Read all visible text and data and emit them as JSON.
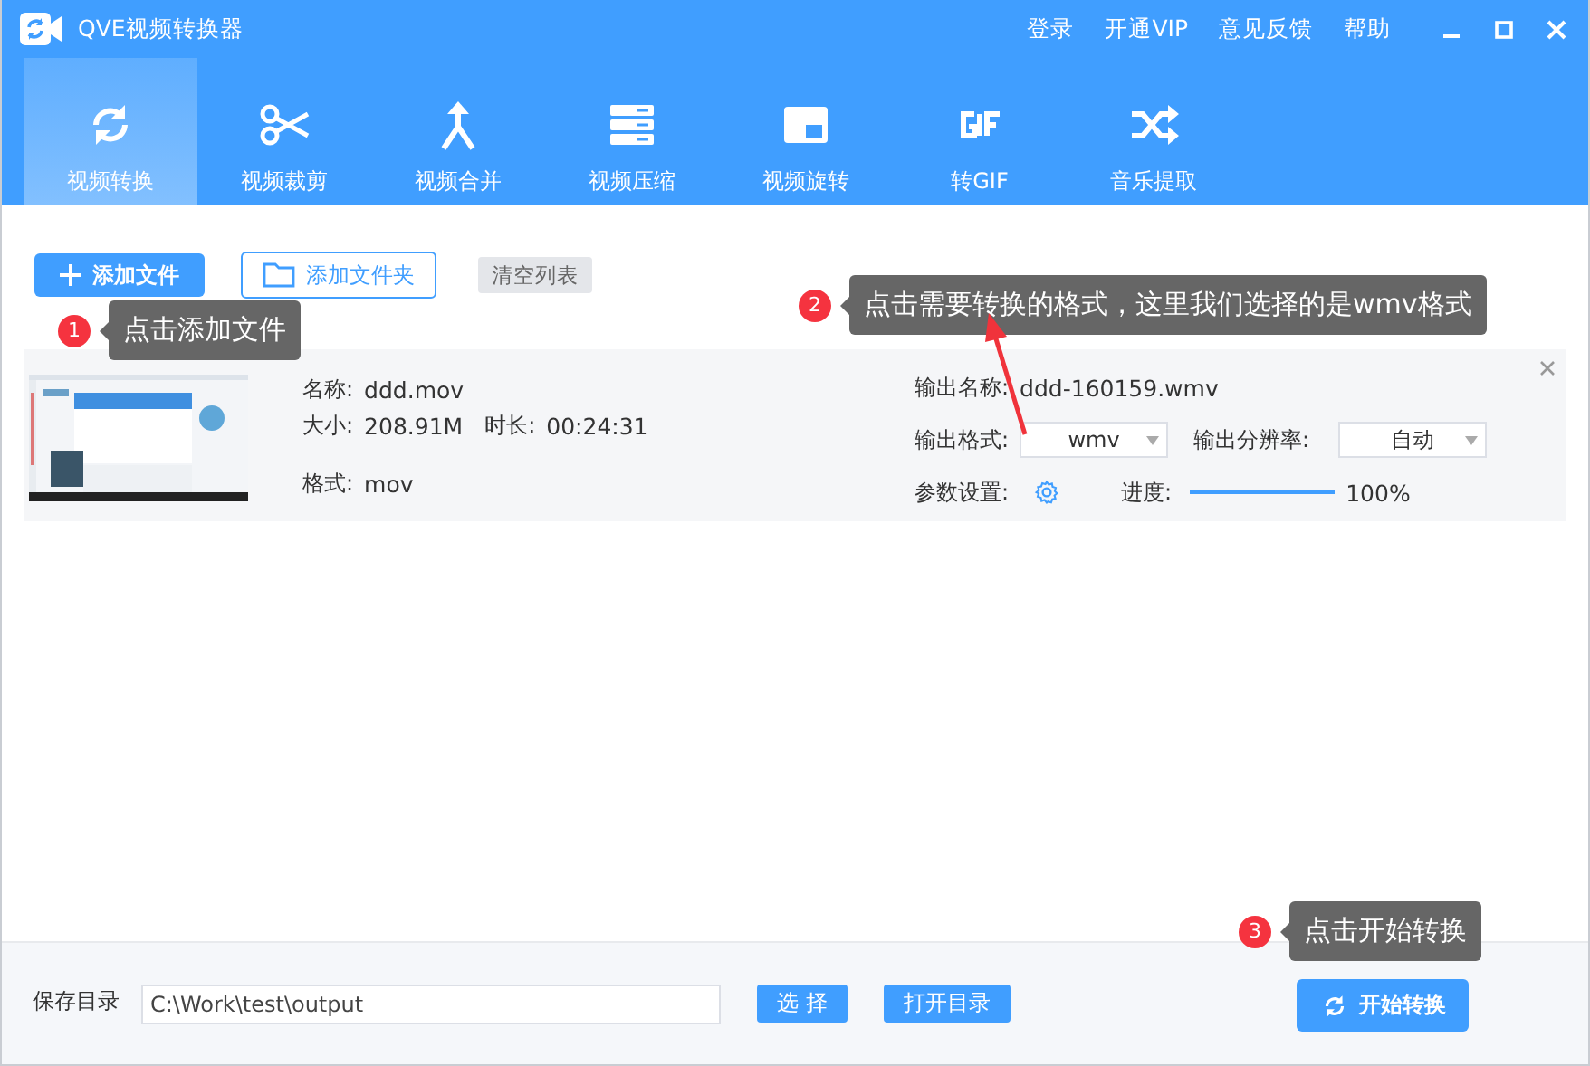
{
  "window": {
    "title": "QVE视频转换器",
    "links": [
      "登录",
      "开通VIP",
      "意见反馈",
      "帮助"
    ]
  },
  "tabs": [
    {
      "label": "视频转换",
      "kind": "convert",
      "selected": true
    },
    {
      "label": "视频裁剪",
      "kind": "cut",
      "selected": false
    },
    {
      "label": "视频合并",
      "kind": "merge",
      "selected": false
    },
    {
      "label": "视频压缩",
      "kind": "compress",
      "selected": false
    },
    {
      "label": "视频旋转",
      "kind": "rotate",
      "selected": false
    },
    {
      "label": "转GIF",
      "kind": "gif",
      "selected": false
    },
    {
      "label": "音乐提取",
      "kind": "audio",
      "selected": false
    }
  ],
  "toolbar": {
    "add_file": "添加文件",
    "add_folder": "添加文件夹",
    "clear": "清空列表"
  },
  "files": [
    {
      "name_label": "名称:",
      "name": "ddd.mov",
      "size_label": "大小:",
      "size": "208.91M",
      "duration_label": "时长:",
      "duration": "00:24:31",
      "format_label": "格式:",
      "format": "mov",
      "output_name_label": "输出名称:",
      "output_name": "ddd-160159.wmv",
      "output_format_label": "输出格式:",
      "output_format": "wmv",
      "resolution_label": "输出分辨率:",
      "resolution": "自动",
      "params_label": "参数设置:",
      "progress_label": "进度:",
      "level": 1,
      "progress": "100%"
    }
  ],
  "bottom": {
    "save_label": "保存目录",
    "path": "C:\\Work\\test\\output",
    "choose": "选 择",
    "open": "打开目录",
    "start": "开始转换"
  },
  "callouts": [
    {
      "number": "1",
      "text": "点击添加文件"
    },
    {
      "number": "2",
      "text": "点击需要转换的格式，这里我们选择的是wmv格式"
    },
    {
      "number": "3",
      "text": "点击开始转换"
    }
  ]
}
